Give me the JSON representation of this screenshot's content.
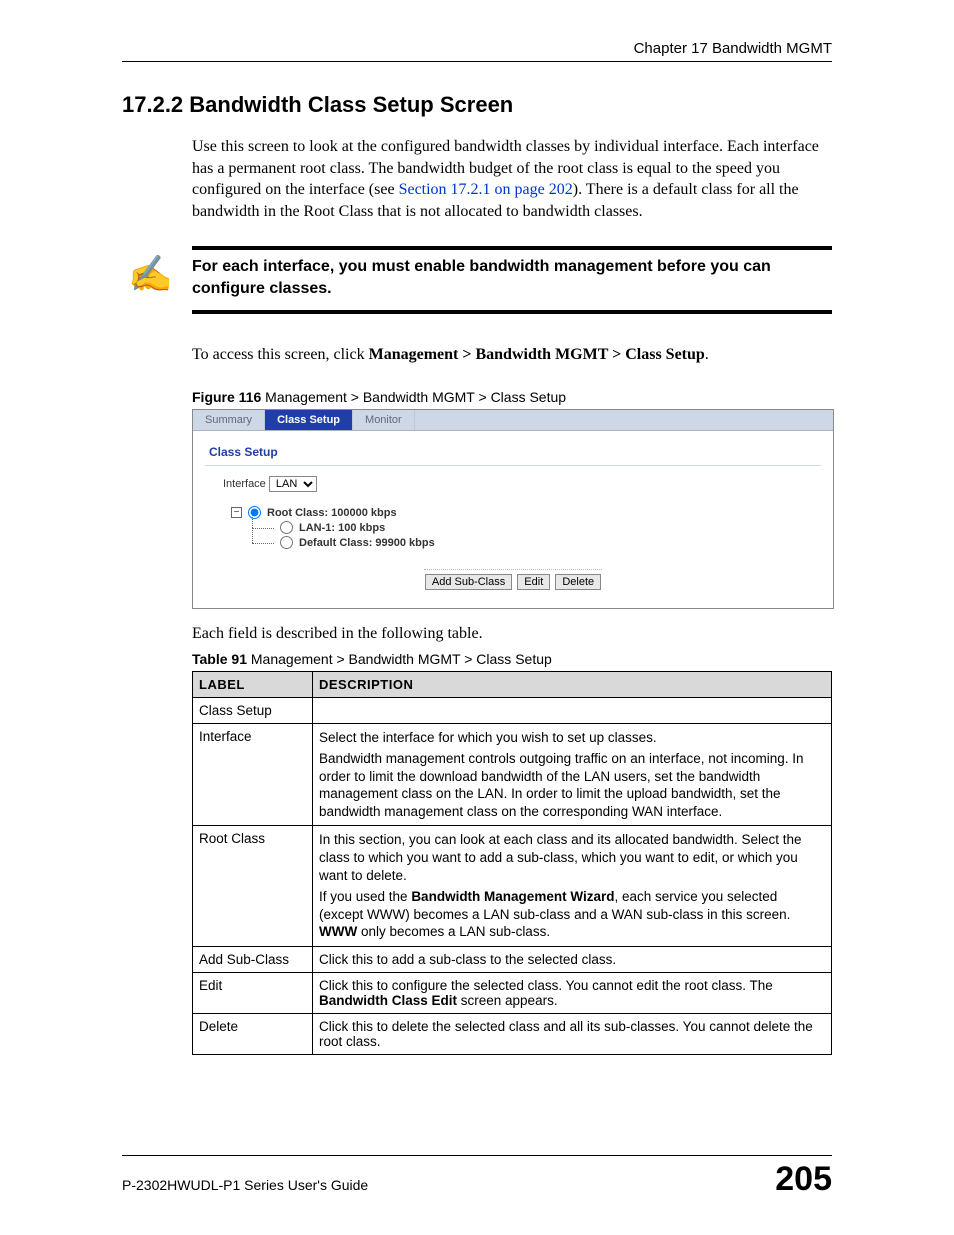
{
  "header": {
    "chapter": "Chapter 17 Bandwidth MGMT"
  },
  "section": {
    "number_title": "17.2.2  Bandwidth Class Setup Screen",
    "para1_a": "Use this screen to look at the configured bandwidth classes by individual interface. Each interface has a permanent root class. The bandwidth budget of the root class is equal to the speed you configured on the interface (see ",
    "para1_link": "Section 17.2.1 on page 202",
    "para1_b": "). There is a default class for all the bandwidth in the Root Class that is not allocated to bandwidth classes.",
    "note_icon": "✍",
    "note_text": "For each interface, you must enable bandwidth management before you can configure classes.",
    "para2_a": "To access this screen, click ",
    "para2_b": "Management > Bandwidth MGMT > Class Setup",
    "para2_c": ".",
    "para3": "Each field is described in the following table."
  },
  "figure": {
    "caption_bold": "Figure 116",
    "caption_rest": "   Management > Bandwidth MGMT > Class Setup",
    "tabs": {
      "summary": "Summary",
      "class_setup": "Class Setup",
      "monitor": "Monitor"
    },
    "panel_title": "Class Setup",
    "interface_label": "Interface",
    "interface_value": "LAN",
    "tree_toggle": "−",
    "root_label": "Root Class: 100000 kbps",
    "child1_label": "LAN-1: 100 kbps",
    "child2_label": "Default Class: 99900 kbps",
    "buttons": {
      "add": "Add Sub-Class",
      "edit": "Edit",
      "delete": "Delete"
    }
  },
  "table": {
    "caption_bold": "Table 91",
    "caption_rest": "   Management > Bandwidth MGMT > Class Setup",
    "headers": {
      "label": "LABEL",
      "desc": "DESCRIPTION"
    },
    "rows": {
      "r0": {
        "label": "Class Setup",
        "desc": ""
      },
      "r1": {
        "label": "Interface",
        "p1": "Select the interface for which you wish to set up classes.",
        "p2": "Bandwidth management controls outgoing traffic on an interface, not incoming. In order to limit the download bandwidth of the LAN users, set the bandwidth management class on the LAN. In order to limit the upload bandwidth, set the bandwidth management class on the corresponding WAN interface."
      },
      "r2": {
        "label": "Root Class",
        "p1": "In this section, you can look at each class and its allocated bandwidth. Select the class to which you want to add a sub-class, which you want to edit, or which you want to delete.",
        "p2a": "If you used the ",
        "p2b": "Bandwidth Management Wizard",
        "p2c": ", each service you selected (except WWW) becomes a LAN sub-class and a WAN sub-class in this screen. ",
        "p2d": "WWW",
        "p2e": " only becomes a LAN sub-class."
      },
      "r3": {
        "label": "Add Sub-Class",
        "p1": "Click this to add a sub-class to the selected class."
      },
      "r4": {
        "label": "Edit",
        "p1a": "Click this to configure the selected class. You cannot edit the root class. The ",
        "p1b": "Bandwidth Class Edit",
        "p1c": " screen appears."
      },
      "r5": {
        "label": "Delete",
        "p1": "Click this to delete the selected class and all its sub-classes. You cannot delete the root class."
      }
    }
  },
  "footer": {
    "left": "P-2302HWUDL-P1 Series User's Guide",
    "right": "205"
  }
}
